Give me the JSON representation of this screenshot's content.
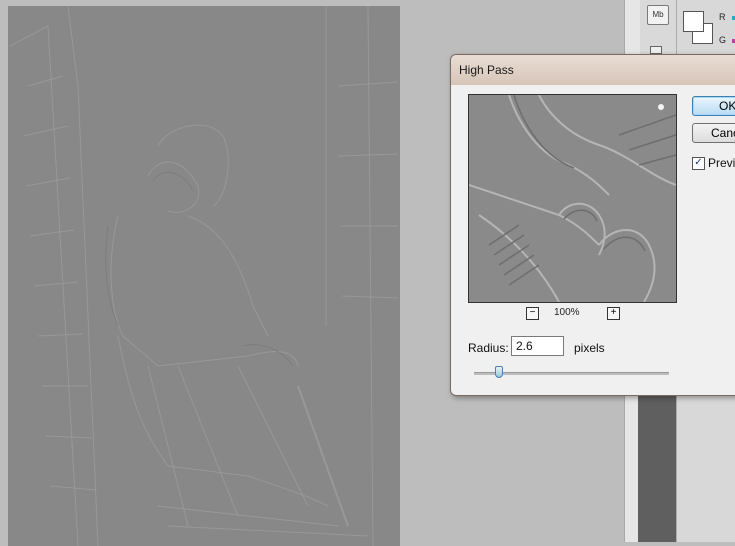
{
  "panel": {
    "tool_icon_text": "Mb",
    "channel_r": "R",
    "channel_g": "G"
  },
  "dialog": {
    "title": "High Pass",
    "ok_label": "OK",
    "cancel_label": "Cancel",
    "preview_label": "Preview",
    "preview_checked": true,
    "zoom_out_label": "−",
    "zoom_in_label": "+",
    "zoom_level": "100%",
    "radius_label": "Radius:",
    "radius_value": "2.6",
    "radius_unit": "pixels",
    "radius_slider_fraction": 0.13
  },
  "colors": {
    "canvas_gray": "#888888",
    "ok_accent": "#3c7fb1",
    "title_bar": "#d7c5b9",
    "channel_r": "#2aa7c9",
    "channel_g": "#c43da0"
  }
}
